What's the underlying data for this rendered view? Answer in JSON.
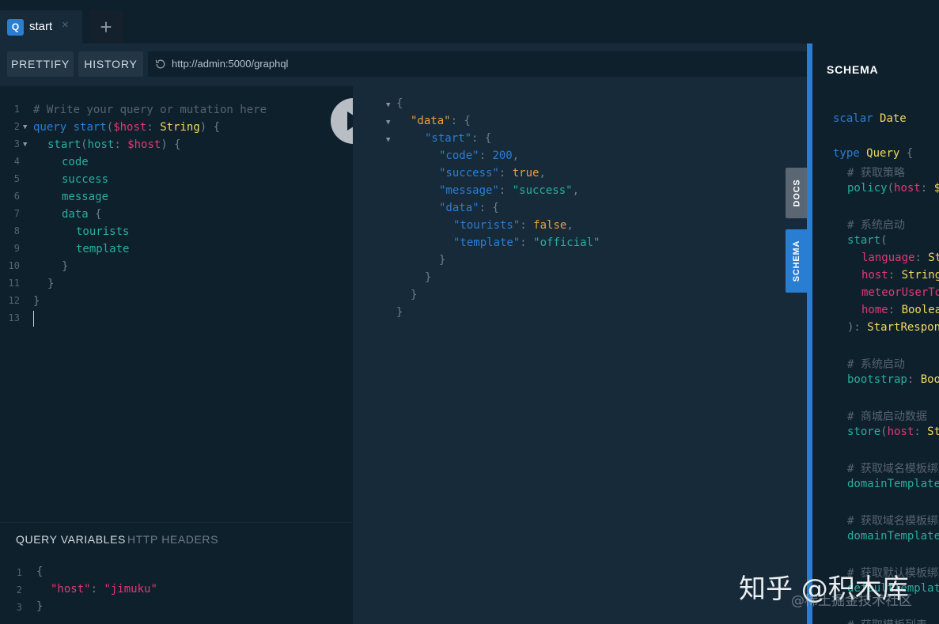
{
  "tabs": [
    {
      "badge": "Q",
      "title": "start",
      "close": "×"
    }
  ],
  "add_tab_label": "+",
  "toolbar": {
    "prettify_label": "PRETTIFY",
    "history_label": "HISTORY",
    "url": "http://admin:5000/graphql"
  },
  "editor": {
    "line_numbers": [
      "1",
      "2",
      "3",
      "4",
      "5",
      "6",
      "7",
      "8",
      "9",
      "10",
      "11",
      "12",
      "13"
    ],
    "comment": "# Write your query or mutation here",
    "kw_query": "query",
    "op_name": "start",
    "var_host": "$host",
    "type_string": "String",
    "field_start": "start",
    "arg_host": "host",
    "field_code": "code",
    "field_success": "success",
    "field_message": "message",
    "field_data": "data",
    "field_tourists": "tourists",
    "field_template": "template"
  },
  "variables": {
    "tab_query_variables": "QUERY VARIABLES",
    "tab_http_headers": "HTTP HEADERS",
    "line_numbers": [
      "1",
      "2",
      "3"
    ],
    "key": "\"host\"",
    "value": "\"jimuku\""
  },
  "result": {
    "k_data": "\"data\"",
    "k_start": "\"start\"",
    "k_code": "\"code\"",
    "v_code": "200",
    "k_success": "\"success\"",
    "v_success": "true",
    "k_message": "\"message\"",
    "v_message": "\"success\"",
    "k_data2": "\"data\"",
    "k_tourists": "\"tourists\"",
    "v_tourists": "false",
    "k_template": "\"template\"",
    "v_template": "\"official\""
  },
  "side_tabs": {
    "docs": "DOCS",
    "schema": "SCHEMA"
  },
  "schema": {
    "title": "SCHEMA",
    "scalar_kw": "scalar",
    "scalar_name": "Date",
    "type_kw": "type",
    "type_name": "Query",
    "c1": "# 获取策略",
    "f_policy": "policy",
    "a_host": "host",
    "c2": "# 系统启动",
    "f_start": "start",
    "a_language": "language",
    "a_host2": "host",
    "a_meteor": "meteorUserToken",
    "a_home": "home",
    "t_st": "St",
    "t_string": "String",
    "t_boolean": "Boolean",
    "t_start_response": "StartResponse",
    "c3": "# 系统启动",
    "f_bootstrap": "bootstrap",
    "t_bootstrap": "Bootstrap",
    "c4": "# 商城启动数据",
    "f_store": "store",
    "a_store_host": "host",
    "c5": "# 获取域名模板绑定",
    "f_domain1": "domainTemplate",
    "c6": "# 获取域名模板绑定",
    "f_domain2": "domainTemplate",
    "c7": "# 获取默认模板绑定",
    "f_default": "defaultTemplate",
    "c8": "# 获取模板列表"
  },
  "watermark": {
    "main": "知乎 @积木库",
    "sub": "@稀土掘金技术社区"
  },
  "colors": {
    "accent": "#2a7ed2",
    "editor_bg": "#0f202d",
    "result_bg": "#172a3a",
    "keyword": "#2a7ed2",
    "variable": "#e13875",
    "type": "#f1da5c",
    "field": "#27ae9e",
    "json_top_key": "#e9a23b"
  }
}
